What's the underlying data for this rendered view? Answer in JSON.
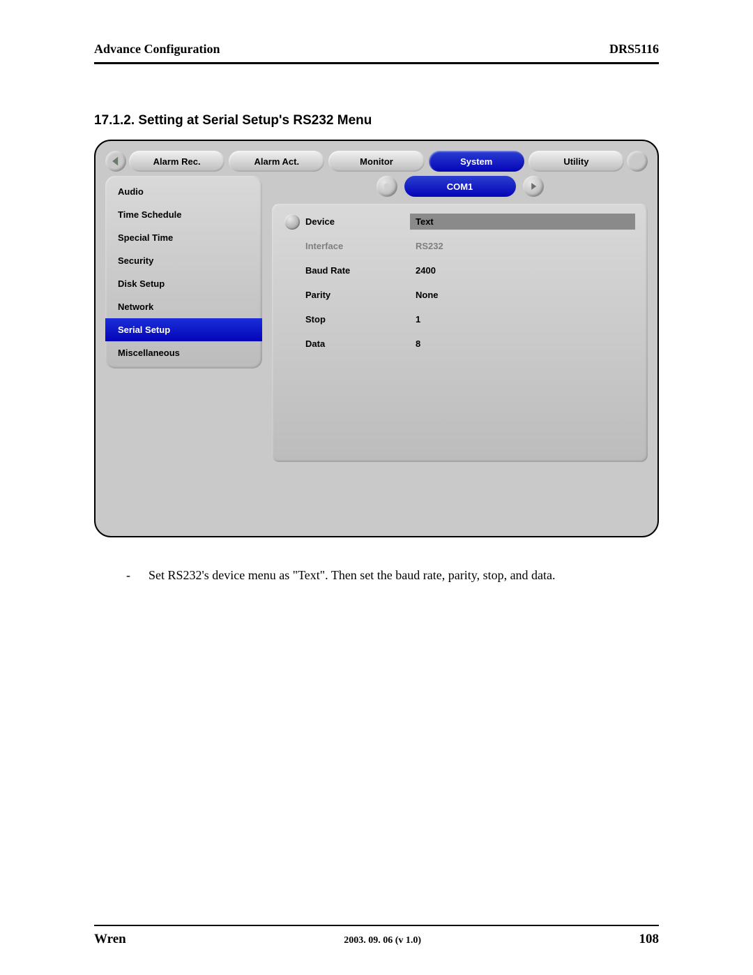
{
  "header": {
    "left": "Advance Configuration",
    "right": "DRS5116"
  },
  "section_title": "17.1.2. Setting at Serial Setup's RS232 Menu",
  "tabs": {
    "items": [
      "Alarm Rec.",
      "Alarm Act.",
      "Monitor",
      "System",
      "Utility"
    ],
    "active_index": 3
  },
  "sidebar": {
    "items": [
      "Audio",
      "Time Schedule",
      "Special Time",
      "Security",
      "Disk Setup",
      "Network",
      "Serial Setup",
      "Miscellaneous"
    ],
    "active_index": 6
  },
  "com_label": "COM1",
  "settings": {
    "rows": [
      {
        "label": "Device",
        "value": "Text",
        "header": true,
        "knob": true
      },
      {
        "label": "Interface",
        "value": "RS232",
        "disabled": true
      },
      {
        "label": "Baud Rate",
        "value": "2400"
      },
      {
        "label": "Parity",
        "value": "None"
      },
      {
        "label": "Stop",
        "value": "1"
      },
      {
        "label": "Data",
        "value": "8"
      }
    ]
  },
  "body_bullet": "-",
  "body_text": "Set RS232's device menu as \"Text\".    Then set the baud rate, parity, stop, and data.",
  "footer": {
    "left": "Wren",
    "center": "2003. 09. 06 (v 1.0)",
    "right": "108"
  }
}
